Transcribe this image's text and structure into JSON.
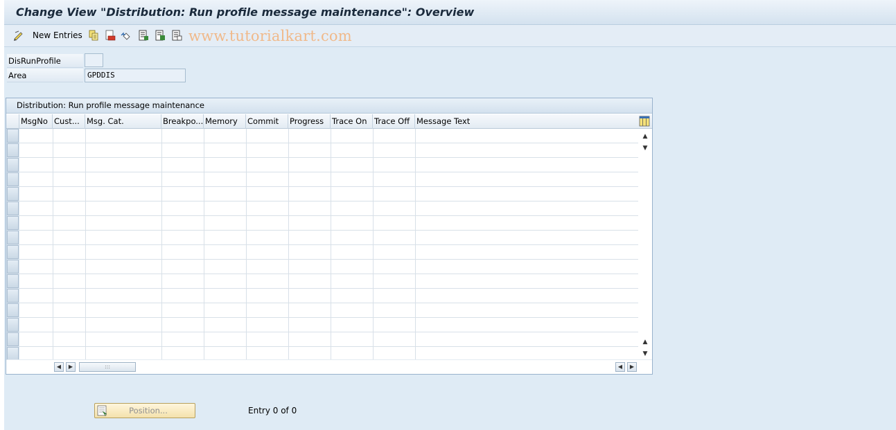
{
  "window": {
    "title": "Change View \"Distribution: Run profile message maintenance\": Overview"
  },
  "toolbar": {
    "new_entries_label": "New Entries",
    "watermark": "www.tutorialkart.com",
    "icons": [
      "display-change-icon",
      "copy-icon",
      "delete-icon",
      "undo-icon",
      "select-all-icon",
      "select-block-icon",
      "deselect-all-icon"
    ]
  },
  "fields": {
    "disrunprofile_label": "DisRunProfile",
    "disrunprofile_value": "",
    "area_label": "Area",
    "area_value": "GPDDIS"
  },
  "table": {
    "title": "Distribution: Run profile message maintenance",
    "columns": [
      "MsgNo",
      "Cust...",
      "Msg. Cat.",
      "Breakpo...",
      "Memory",
      "Commit",
      "Progress",
      "Trace On",
      "Trace Off",
      "Message Text"
    ],
    "rows": []
  },
  "footer": {
    "position_button_label": "Position...",
    "entry_text": "Entry 0 of 0"
  }
}
